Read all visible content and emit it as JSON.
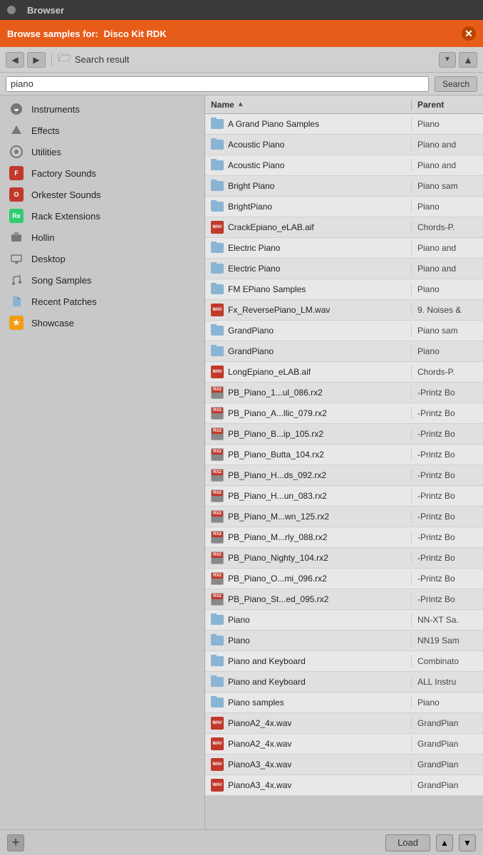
{
  "titleBar": {
    "title": "Browser"
  },
  "banner": {
    "label": "Browse samples for:",
    "name": "Disco Kit RDK"
  },
  "nav": {
    "location": "Search result",
    "backLabel": "◀",
    "forwardLabel": "▶",
    "upLabel": "▲",
    "dropdownLabel": "▼"
  },
  "search": {
    "value": "piano",
    "placeholder": "piano",
    "buttonLabel": "Search"
  },
  "sidebar": {
    "items": [
      {
        "id": "instruments",
        "label": "Instruments",
        "iconType": "instruments"
      },
      {
        "id": "effects",
        "label": "Effects",
        "iconType": "effects"
      },
      {
        "id": "utilities",
        "label": "Utilities",
        "iconType": "utilities"
      },
      {
        "id": "factory",
        "label": "Factory Sounds",
        "iconType": "factory"
      },
      {
        "id": "orkester",
        "label": "Orkester Sounds",
        "iconType": "orkester"
      },
      {
        "id": "rack",
        "label": "Rack Extensions",
        "iconType": "rack"
      },
      {
        "id": "hollin",
        "label": "Hollin",
        "iconType": "hollin"
      },
      {
        "id": "desktop",
        "label": "Desktop",
        "iconType": "desktop"
      },
      {
        "id": "song",
        "label": "Song Samples",
        "iconType": "song"
      },
      {
        "id": "recent",
        "label": "Recent Patches",
        "iconType": "recent"
      },
      {
        "id": "showcase",
        "label": "Showcase",
        "iconType": "showcase"
      }
    ]
  },
  "fileList": {
    "columns": {
      "name": "Name",
      "parent": "Parent"
    },
    "rows": [
      {
        "name": "A Grand Piano Samples",
        "parent": "Piano",
        "type": "folder"
      },
      {
        "name": "Acoustic Piano",
        "parent": "Piano and",
        "type": "folder"
      },
      {
        "name": "Acoustic Piano",
        "parent": "Piano and",
        "type": "folder"
      },
      {
        "name": "Bright Piano",
        "parent": "Piano sam",
        "type": "folder"
      },
      {
        "name": "BrightPiano",
        "parent": "Piano",
        "type": "folder"
      },
      {
        "name": "CrackEpiano_eLAB.aif",
        "parent": "Chords-P.",
        "type": "wav"
      },
      {
        "name": "Electric Piano",
        "parent": "Piano and",
        "type": "folder"
      },
      {
        "name": "Electric Piano",
        "parent": "Piano and",
        "type": "folder"
      },
      {
        "name": "FM EPiano Samples",
        "parent": "Piano",
        "type": "folder"
      },
      {
        "name": "Fx_ReversePiano_LM.wav",
        "parent": "9. Noises &",
        "type": "wav"
      },
      {
        "name": "GrandPiano",
        "parent": "Piano sam",
        "type": "folder"
      },
      {
        "name": "GrandPiano",
        "parent": "Piano",
        "type": "folder"
      },
      {
        "name": "LongEpiano_eLAB.aif",
        "parent": "Chords-P.",
        "type": "wav"
      },
      {
        "name": "PB_Piano_1...ul_086.rx2",
        "parent": "-Printz Bo",
        "type": "rx2"
      },
      {
        "name": "PB_Piano_A...llic_079.rx2",
        "parent": "-Printz Bo",
        "type": "rx2"
      },
      {
        "name": "PB_Piano_B...ip_105.rx2",
        "parent": "-Printz Bo",
        "type": "rx2"
      },
      {
        "name": "PB_Piano_Butta_104.rx2",
        "parent": "-Printz Bo",
        "type": "rx2"
      },
      {
        "name": "PB_Piano_H...ds_092.rx2",
        "parent": "-Printz Bo",
        "type": "rx2"
      },
      {
        "name": "PB_Piano_H...un_083.rx2",
        "parent": "-Printz Bo",
        "type": "rx2"
      },
      {
        "name": "PB_Piano_M...wn_125.rx2",
        "parent": "-Printz Bo",
        "type": "rx2"
      },
      {
        "name": "PB_Piano_M...rly_088.rx2",
        "parent": "-Printz Bo",
        "type": "rx2"
      },
      {
        "name": "PB_Piano_Nighty_104.rx2",
        "parent": "-Printz Bo",
        "type": "rx2"
      },
      {
        "name": "PB_Piano_O...mi_096.rx2",
        "parent": "-Printz Bo",
        "type": "rx2"
      },
      {
        "name": "PB_Piano_St...ed_095.rx2",
        "parent": "-Printz Bo",
        "type": "rx2"
      },
      {
        "name": "Piano",
        "parent": "NN-XT Sa.",
        "type": "folder"
      },
      {
        "name": "Piano",
        "parent": "NN19 Sam",
        "type": "folder"
      },
      {
        "name": "Piano and Keyboard",
        "parent": "Combinato",
        "type": "folder"
      },
      {
        "name": "Piano and Keyboard",
        "parent": "ALL Instru",
        "type": "folder"
      },
      {
        "name": "Piano samples",
        "parent": "Piano",
        "type": "folder"
      },
      {
        "name": "PianoA2_4x.wav",
        "parent": "GrandPian",
        "type": "wav"
      },
      {
        "name": "PianoA2_4x.wav",
        "parent": "GrandPian",
        "type": "wav"
      },
      {
        "name": "PianoA3_4x.wav",
        "parent": "GrandPian",
        "type": "wav"
      },
      {
        "name": "PianoA3_4x.wav",
        "parent": "GrandPian",
        "type": "wav"
      }
    ]
  },
  "bottomBar": {
    "addLabel": "+",
    "loadLabel": "Load",
    "upArrow": "▲",
    "downArrow": "▼"
  }
}
